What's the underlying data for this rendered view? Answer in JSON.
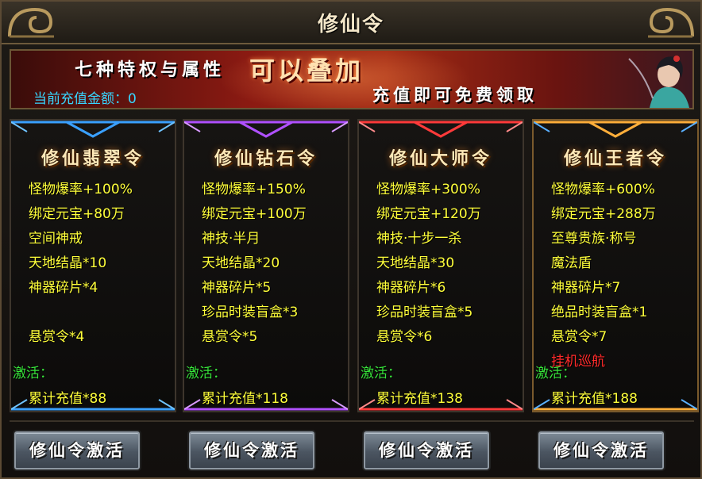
{
  "window": {
    "title": "修仙令"
  },
  "banner": {
    "line1a": "七种特权与属性",
    "line1b": "可以叠加",
    "line2": "充值即可免费领取",
    "recharge_label": "当前充值金额：0"
  },
  "cards": [
    {
      "name": "修仙翡翠令",
      "perks": [
        "怪物爆率+100%",
        "绑定元宝+80万",
        "空间神戒",
        "天地结晶*10",
        "神器碎片*4",
        "",
        "悬赏令*4",
        ""
      ],
      "activate_label": "激活：",
      "requirement": "累计充值*88",
      "accent": "#3aa0ff"
    },
    {
      "name": "修仙钻石令",
      "perks": [
        "怪物爆率+150%",
        "绑定元宝+100万",
        "神技·半月",
        "天地结晶*20",
        "神器碎片*5",
        "珍品时装盲盒*3",
        "悬赏令*5",
        ""
      ],
      "activate_label": "激活：",
      "requirement": "累计充值*118",
      "accent": "#b050ff"
    },
    {
      "name": "修仙大师令",
      "perks": [
        "怪物爆率+300%",
        "绑定元宝+120万",
        "神技·十步一杀",
        "天地结晶*30",
        "神器碎片*6",
        "珍品时装盲盒*5",
        "悬赏令*6",
        ""
      ],
      "activate_label": "激活：",
      "requirement": "累计充值*138",
      "accent": "#ff3a3a"
    },
    {
      "name": "修仙王者令",
      "perks": [
        "怪物爆率+600%",
        "绑定元宝+288万",
        "至尊贵族·称号",
        "魔法盾",
        "神器碎片*7",
        "绝品时装盲盒*1",
        "悬赏令*7",
        "挂机巡航"
      ],
      "activate_label": "激活：",
      "requirement": "累计充值*188",
      "accent": "#ffae3a"
    }
  ],
  "buttons": {
    "activate_label": "修仙令激活"
  }
}
